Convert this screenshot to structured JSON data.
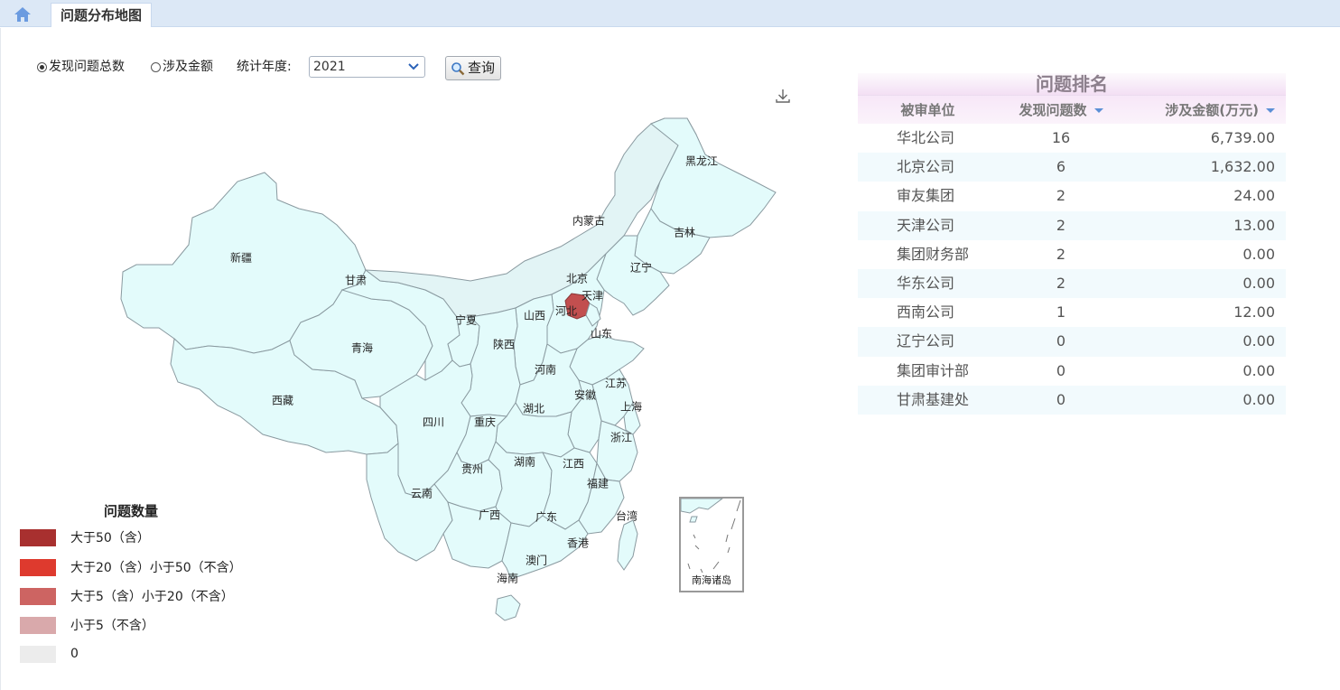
{
  "tabs": {
    "home_icon": "home-icon",
    "active_label": "问题分布地图"
  },
  "controls": {
    "radio_total": "发现问题总数",
    "radio_amount": "涉及金额",
    "selected": "total",
    "year_label": "统计年度:",
    "year_value": "2021",
    "query_label": "查询"
  },
  "map": {
    "labels": {
      "heilongjiang": "黑龙江",
      "neimenggu": "内蒙古",
      "jilin": "吉林",
      "liaoning": "辽宁",
      "xinjiang": "新疆",
      "gansu": "甘肃",
      "beijing": "北京",
      "tianjin": "天津",
      "hebei": "河北",
      "shanxi": "山西",
      "ningxia": "宁夏",
      "qinghai": "青海",
      "shaanxi": "陕西",
      "shandong": "山东",
      "henan": "河南",
      "xizang": "西藏",
      "jiangsu": "江苏",
      "anhui": "安徽",
      "shanghai": "上海",
      "sichuan": "四川",
      "chongqing": "重庆",
      "hubei": "湖北",
      "zhejiang": "浙江",
      "guizhou": "贵州",
      "hunan": "湖南",
      "jiangxi": "江西",
      "fujian": "福建",
      "yunnan": "云南",
      "taiwan": "台湾",
      "guangxi": "广西",
      "guangdong": "广东",
      "hongkong": "香港",
      "macau": "澳门",
      "hainan": "海南",
      "nanhai": "南海诸岛"
    },
    "highlight_color": "#c24f4f",
    "base_color": "#e3fbfb"
  },
  "legend": {
    "title": "问题数量",
    "items": [
      {
        "label": "大于50（含）",
        "color": "#a8302f"
      },
      {
        "label": "大于20（含）小于50（不含）",
        "color": "#de3a2e"
      },
      {
        "label": "大于5（含）小于20（不含）",
        "color": "#cd6462"
      },
      {
        "label": "小于5（不含）",
        "color": "#d9a9ab"
      },
      {
        "label": "0",
        "color": "#ececec"
      }
    ]
  },
  "ranking": {
    "title": "问题排名",
    "headers": {
      "unit": "被审单位",
      "count": "发现问题数",
      "amount": "涉及金额(万元)"
    },
    "rows": [
      {
        "unit": "华北公司",
        "count": "16",
        "amount": "6,739.00"
      },
      {
        "unit": "北京公司",
        "count": "6",
        "amount": "1,632.00"
      },
      {
        "unit": "审友集团",
        "count": "2",
        "amount": "24.00"
      },
      {
        "unit": "天津公司",
        "count": "2",
        "amount": "13.00"
      },
      {
        "unit": "集团财务部",
        "count": "2",
        "amount": "0.00"
      },
      {
        "unit": "华东公司",
        "count": "2",
        "amount": "0.00"
      },
      {
        "unit": "西南公司",
        "count": "1",
        "amount": "12.00"
      },
      {
        "unit": "辽宁公司",
        "count": "0",
        "amount": "0.00"
      },
      {
        "unit": "集团审计部",
        "count": "0",
        "amount": "0.00"
      },
      {
        "unit": "甘肃基建处",
        "count": "0",
        "amount": "0.00"
      }
    ]
  }
}
